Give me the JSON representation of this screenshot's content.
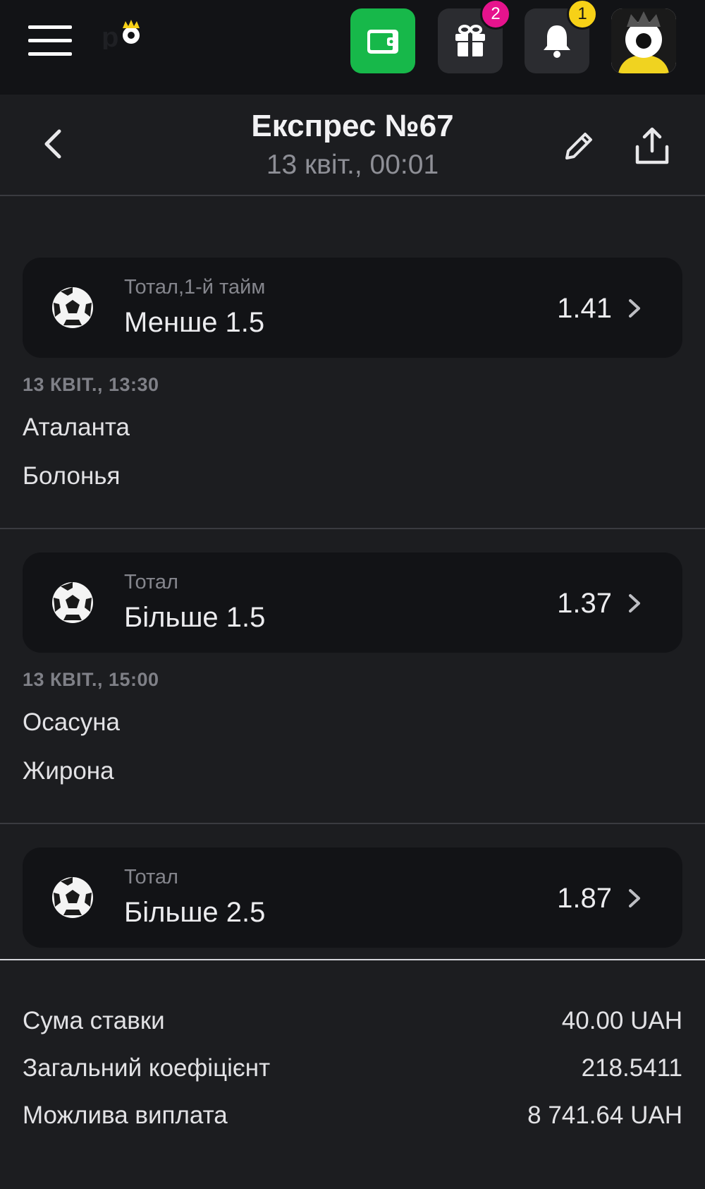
{
  "topbar": {
    "gift_badge": "2",
    "bell_badge": "1",
    "accent_green": "#17b84a",
    "badge_pink": "#e6138d",
    "badge_yellow": "#f7d117"
  },
  "header": {
    "title": "Експрес №67",
    "subtitle": "13 квіт., 00:01"
  },
  "bets": [
    {
      "market": "Тотал,1-й тайм",
      "selection": "Менше 1.5",
      "odds": "1.41",
      "date": "13 КВІТ., 13:30",
      "team1": "Аталанта",
      "team2": "Болонья"
    },
    {
      "market": "Тотал",
      "selection": "Більше 1.5",
      "odds": "1.37",
      "date": "13 КВІТ., 15:00",
      "team1": "Осасуна",
      "team2": "Жирона"
    },
    {
      "market": "Тотал",
      "selection": "Більше 2.5",
      "odds": "1.87"
    }
  ],
  "summary": {
    "stake_label": "Сума ставки",
    "stake_value": "40.00 UAH",
    "total_odds_label": "Загальний коефіцієнт",
    "total_odds_value": "218.5411",
    "payout_label": "Можлива виплата",
    "payout_value": "8 741.64 UAH"
  }
}
